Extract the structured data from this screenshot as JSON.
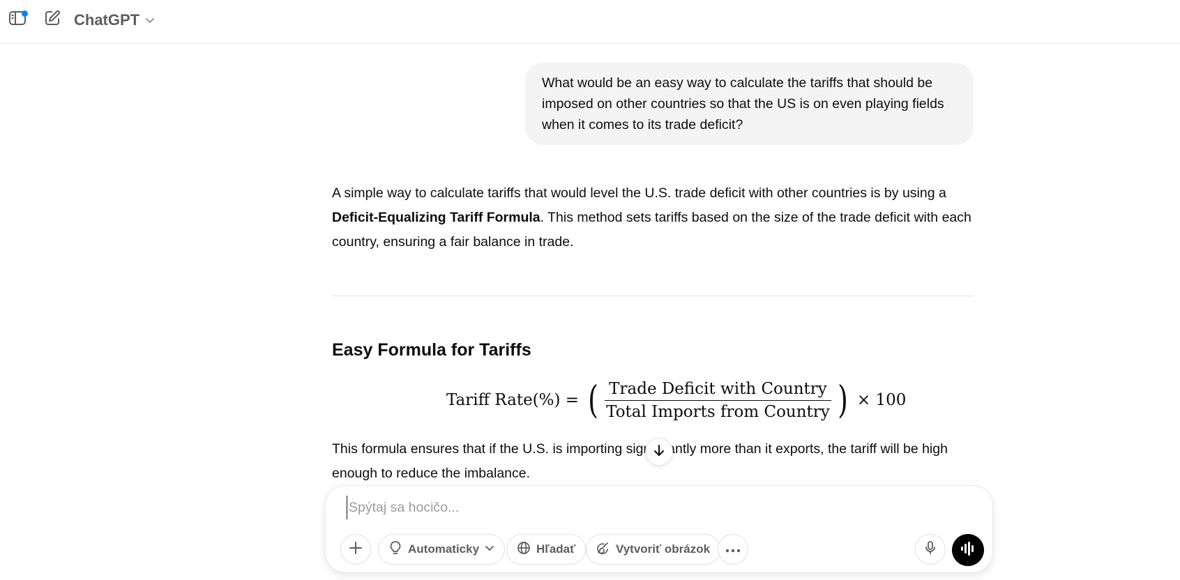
{
  "header": {
    "model_name": "ChatGPT"
  },
  "conversation": {
    "user_message": "What would be an easy way to calculate the tariffs that should be imposed on other countries so that the US is on even playing fields when it comes to its trade deficit?",
    "assistant": {
      "intro_before": "A simple way to calculate tariffs that would level the U.S. trade deficit with other countries is by using a ",
      "intro_bold": "Deficit-Equalizing Tariff Formula",
      "intro_after": ". This method sets tariffs based on the size of the trade deficit with each country, ensuring a fair balance in trade.",
      "section_title": "Easy Formula for Tariffs",
      "formula": {
        "lhs": "Tariff Rate(%) =",
        "numerator": "Trade Deficit with Country",
        "denominator": "Total Imports from Country",
        "multiplier": "× 100"
      },
      "followup_text": "This formula ensures that if the U.S. is importing significantly more than it exports, the tariff will be high enough to reduce the imbalance."
    }
  },
  "composer": {
    "placeholder": "Spýtaj sa hocičo...",
    "value": "",
    "tools": {
      "auto_label": "Automaticky",
      "search_label": "Hľadať",
      "image_label": "Vytvoriť obrázok"
    }
  },
  "colors": {
    "notification_dot": "#0285ff",
    "bubble_bg": "#f4f4f4",
    "voice_button_bg": "#000000"
  }
}
